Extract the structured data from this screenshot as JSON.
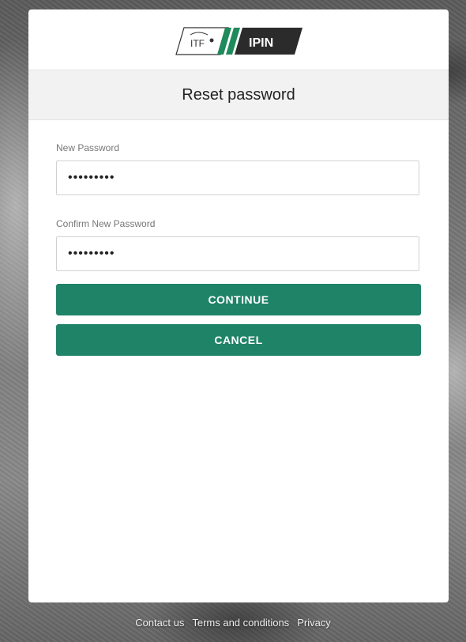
{
  "logo": {
    "itf_text": "ITF",
    "product": "IPIN"
  },
  "page_title": "Reset password",
  "new_password": {
    "label": "New Password",
    "value": "•••••••••"
  },
  "confirm_password": {
    "label": "Confirm New Password",
    "value": "•••••••••"
  },
  "buttons": {
    "continue": "CONTINUE",
    "cancel": "CANCEL"
  },
  "footer": {
    "contact": "Contact us",
    "terms": "Terms and conditions",
    "privacy": "Privacy"
  },
  "colors": {
    "primary_button": "#1f8367",
    "logo_dark": "#2b2b2b",
    "logo_green": "#1f8a5b"
  }
}
